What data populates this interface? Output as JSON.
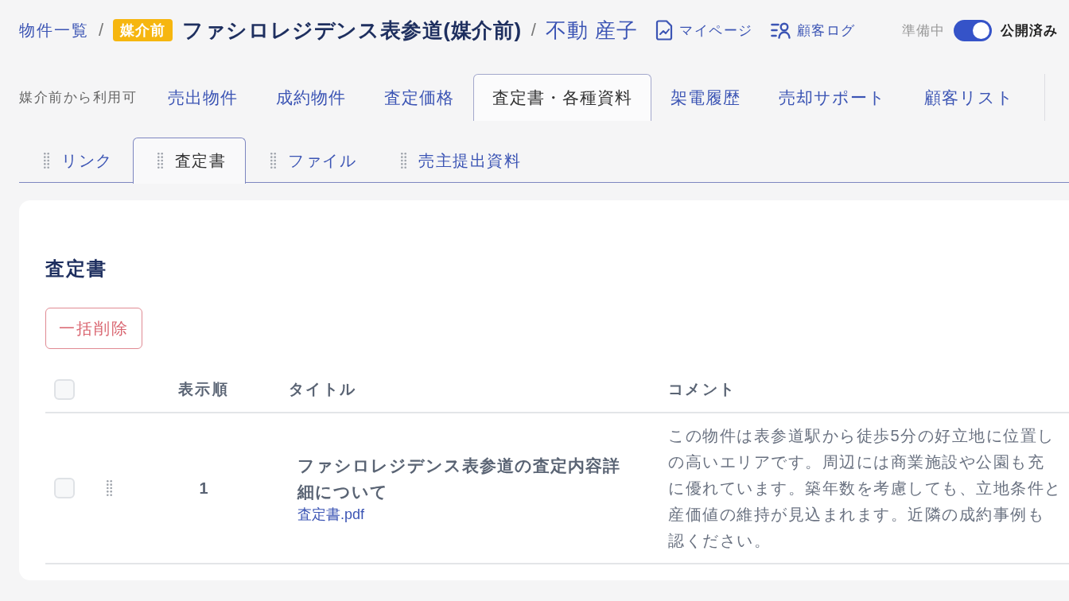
{
  "breadcrumb": [
    {
      "kind": "link",
      "text": "物件一覧"
    },
    {
      "kind": "separator",
      "text": "/"
    },
    {
      "kind": "badge",
      "text": "媒介前"
    },
    {
      "kind": "title",
      "text": "ファシロレジデンス表参道(媒介前)"
    },
    {
      "kind": "separator",
      "text": "/"
    },
    {
      "kind": "user",
      "text": "不動 産子"
    }
  ],
  "header_links": [
    {
      "kind": "mypage",
      "label": "マイページ"
    },
    {
      "kind": "customer_log",
      "label": "顧客ログ"
    }
  ],
  "publish_toggle": {
    "off_label": "準備中",
    "on_label": "公開済み",
    "on": true
  },
  "main_tabs": {
    "caption": "媒介前から利用可",
    "items": [
      {
        "label": "売出物件",
        "selected": false
      },
      {
        "label": "成約物件",
        "selected": false
      },
      {
        "label": "査定価格",
        "selected": false
      },
      {
        "label": "査定書・各種資料",
        "selected": true
      },
      {
        "label": "架電履歴",
        "selected": false
      },
      {
        "label": "売却サポート",
        "selected": false
      },
      {
        "label": "顧客リスト",
        "selected": false
      }
    ]
  },
  "sub_tabs": [
    {
      "label": "リンク",
      "selected": false
    },
    {
      "label": "査定書",
      "selected": true
    },
    {
      "label": "ファイル",
      "selected": false
    },
    {
      "label": "売主提出資料",
      "selected": false
    }
  ],
  "section": {
    "title": "査定書",
    "bulk_delete_button": "一括削除",
    "table": {
      "select_all_checked": false,
      "columns": [
        "表示順",
        "タイトル",
        "コメント"
      ],
      "rows": [
        {
          "checked": false,
          "order": "1",
          "title": "ファシロレジデンス表参道の査定内容詳細について",
          "file": "査定書.pdf",
          "comment_lines": [
            "この物件は表参道駅から徒歩5分の好立地に位置し",
            "の高いエリアです。周辺には商業施設や公園も充",
            "に優れています。築年数を考慮しても、立地条件と",
            "産価値の維持が見込まれます。近隣の成約事例も",
            "認ください。"
          ]
        }
      ]
    }
  }
}
